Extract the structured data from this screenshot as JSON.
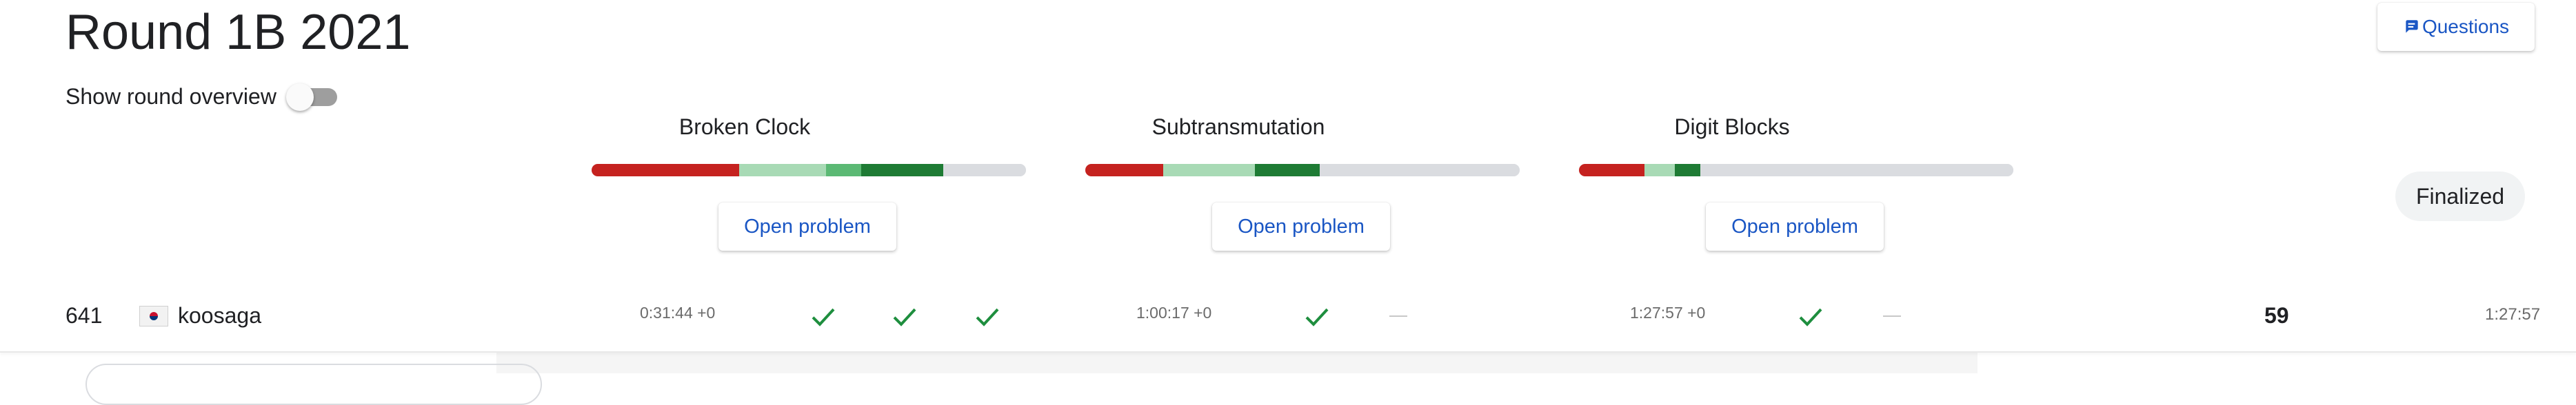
{
  "page": {
    "title": "Round 1B 2021"
  },
  "toggle": {
    "label": "Show round overview",
    "on": false
  },
  "questions_button": {
    "label": "Questions",
    "icon": "comment-icon"
  },
  "status_badge": "Finalized",
  "colors": {
    "red": "#c5221f",
    "green_light": "#a8dab5",
    "green_mid": "#5bb974",
    "green_dark": "#1e7b34",
    "grey": "#dadce0",
    "link": "#1a56c4",
    "check": "#1e8e3e"
  },
  "problems": [
    {
      "name": "Broken Clock",
      "open_label": "Open problem",
      "bar": [
        {
          "color": "#c5221f",
          "fraction": 0.34
        },
        {
          "color": "#a8dab5",
          "fraction": 0.2
        },
        {
          "color": "#5bb974",
          "fraction": 0.08
        },
        {
          "color": "#1e7b34",
          "fraction": 0.19
        },
        {
          "color": "#dadce0",
          "fraction": 0.19
        }
      ],
      "time": "0:31:44 +0",
      "results": [
        "check",
        "check",
        "check"
      ]
    },
    {
      "name": "Subtransmutation",
      "open_label": "Open problem",
      "bar": [
        {
          "color": "#c5221f",
          "fraction": 0.18
        },
        {
          "color": "#a8dab5",
          "fraction": 0.21
        },
        {
          "color": "#1e7b34",
          "fraction": 0.15
        },
        {
          "color": "#dadce0",
          "fraction": 0.46
        }
      ],
      "time": "1:00:17 +0",
      "results": [
        "check",
        "dash"
      ]
    },
    {
      "name": "Digit Blocks",
      "open_label": "Open problem",
      "bar": [
        {
          "color": "#c5221f",
          "fraction": 0.15
        },
        {
          "color": "#a8dab5",
          "fraction": 0.07
        },
        {
          "color": "#1e7b34",
          "fraction": 0.06
        },
        {
          "color": "#dadce0",
          "fraction": 0.72
        }
      ],
      "time": "1:27:57 +0",
      "results": [
        "check",
        "dash"
      ]
    }
  ],
  "row": {
    "rank": "641",
    "country_flag": "south-korea-flag-icon",
    "username": "koosaga",
    "score": "59",
    "total_time": "1:27:57"
  }
}
